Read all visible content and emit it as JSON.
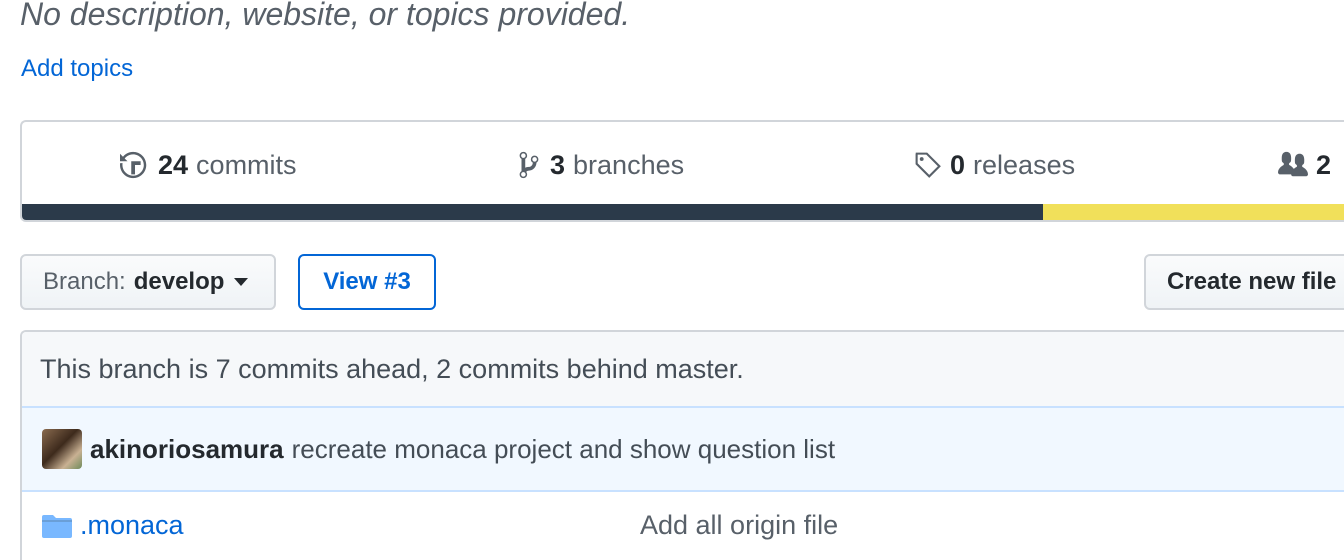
{
  "repo": {
    "description": "No description, website, or topics provided.",
    "add_topics": "Add topics"
  },
  "summary": {
    "commits": {
      "count": "24",
      "label": "commits",
      "icon": "history-icon"
    },
    "branches": {
      "count": "3",
      "label": "branches",
      "icon": "git-branch-icon"
    },
    "releases": {
      "count": "0",
      "label": "releases",
      "icon": "tag-icon"
    },
    "contributors": {
      "count": "2",
      "label": "",
      "icon": "people-icon"
    },
    "languages": [
      {
        "color": "#2b3a4a",
        "percent": 76.3
      },
      {
        "color": "#f1e05a",
        "percent": 23.7
      }
    ]
  },
  "toolbar": {
    "branch_prefix": "Branch:",
    "branch_name": "develop",
    "view_pr": "View #3",
    "create_new_file": "Create new file"
  },
  "branch_status": "This branch is 7 commits ahead, 2 commits behind master.",
  "latest_commit": {
    "author": "akinoriosamura",
    "message": "recreate monaca project and show question list"
  },
  "files": [
    {
      "name": ".monaca",
      "type": "folder",
      "message": "Add all origin file"
    }
  ],
  "colors": {
    "link": "#0366d6",
    "muted": "#586069",
    "text": "#24292e",
    "border": "#d1d5da"
  }
}
